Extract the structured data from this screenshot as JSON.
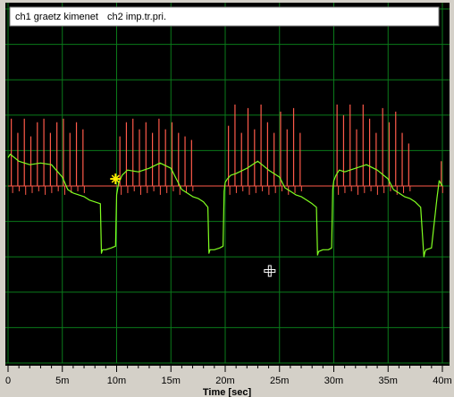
{
  "legend": {
    "ch1_label": "ch1  graetz kimenet",
    "ch2_label": "ch2  imp.tr.pri."
  },
  "colors": {
    "background": "#000000",
    "grid": "#0a7a1a",
    "ch1": "#80ff20",
    "ch2": "#ff5a4a",
    "marker": "#ffee00",
    "cursor": "#ffffff",
    "frame": "#d4d0c8"
  },
  "icons": {
    "marker": "marker-star-icon",
    "cursor": "crosshair-cursor-icon"
  },
  "chart_data": {
    "type": "line",
    "xlabel": "Time [sec]",
    "x_unit": "s",
    "xlim": [
      0,
      0.04
    ],
    "ylim": [
      -1,
      1
    ],
    "y_divisions": 10,
    "x_ticks": [
      0,
      0.005,
      0.01,
      0.015,
      0.02,
      0.025,
      0.03,
      0.035,
      0.04
    ],
    "x_tick_labels": [
      "0",
      "5m",
      "10m",
      "15m",
      "20m",
      "25m",
      "30m",
      "35m",
      "40m"
    ],
    "grid": true,
    "series": [
      {
        "name": "ch1  graetz kimenet",
        "color": "#80ff20",
        "x": [
          0,
          0.0002,
          0.001,
          0.002,
          0.003,
          0.004,
          0.005,
          0.0055,
          0.006,
          0.0065,
          0.007,
          0.0075,
          0.0085,
          0.0086,
          0.0087,
          0.009,
          0.0095,
          0.0099,
          0.01,
          0.0102,
          0.0105,
          0.011,
          0.012,
          0.013,
          0.014,
          0.015,
          0.0155,
          0.016,
          0.0165,
          0.017,
          0.0175,
          0.018,
          0.0184,
          0.0185,
          0.0186,
          0.019,
          0.0195,
          0.0198,
          0.0199,
          0.02,
          0.0202,
          0.0205,
          0.021,
          0.022,
          0.023,
          0.024,
          0.025,
          0.0255,
          0.026,
          0.0265,
          0.027,
          0.0275,
          0.028,
          0.0284,
          0.0285,
          0.0286,
          0.029,
          0.0295,
          0.0298,
          0.0299,
          0.03,
          0.0302,
          0.0305,
          0.031,
          0.032,
          0.033,
          0.034,
          0.035,
          0.0355,
          0.036,
          0.0365,
          0.037,
          0.0375,
          0.038,
          0.0383,
          0.0384,
          0.0385,
          0.039,
          0.0395,
          0.0397,
          0.04
        ],
        "y": [
          0.16,
          0.18,
          0.14,
          0.12,
          0.13,
          0.12,
          0.05,
          -0.02,
          -0.04,
          -0.05,
          -0.06,
          -0.08,
          -0.1,
          -0.38,
          -0.36,
          -0.36,
          -0.35,
          -0.34,
          -0.05,
          0.02,
          0.06,
          0.09,
          0.08,
          0.1,
          0.13,
          0.1,
          0.04,
          -0.02,
          -0.04,
          -0.06,
          -0.07,
          -0.09,
          -0.12,
          -0.38,
          -0.36,
          -0.36,
          -0.35,
          -0.34,
          -0.03,
          0.02,
          0.04,
          0.06,
          0.07,
          0.1,
          0.14,
          0.09,
          0.05,
          -0.01,
          -0.03,
          -0.05,
          -0.06,
          -0.08,
          -0.1,
          -0.12,
          -0.39,
          -0.37,
          -0.36,
          -0.36,
          -0.35,
          -0.02,
          0.03,
          0.06,
          0.09,
          0.08,
          0.1,
          0.12,
          0.09,
          0.04,
          -0.02,
          -0.04,
          -0.06,
          -0.07,
          -0.09,
          -0.12,
          -0.4,
          -0.37,
          -0.36,
          -0.35,
          -0.07,
          0.03,
          0.0
        ]
      },
      {
        "name": "ch2  imp.tr.pri.",
        "color": "#ff5a4a",
        "baseline": 0.0,
        "spike_x": [
          0.0003,
          0.0009,
          0.0015,
          0.0021,
          0.0027,
          0.0033,
          0.0039,
          0.0045,
          0.0051,
          0.0057,
          0.0063,
          0.0069,
          0.0103,
          0.0109,
          0.0115,
          0.0121,
          0.0127,
          0.0133,
          0.0139,
          0.0145,
          0.0151,
          0.0157,
          0.0163,
          0.0169,
          0.0203,
          0.0209,
          0.0215,
          0.0221,
          0.0227,
          0.0233,
          0.0239,
          0.0245,
          0.0251,
          0.0257,
          0.0263,
          0.0269,
          0.0303,
          0.0309,
          0.0315,
          0.0321,
          0.0327,
          0.0333,
          0.0339,
          0.0345,
          0.0351,
          0.0357,
          0.0363,
          0.0369,
          0.0399
        ],
        "spike_y": [
          0.38,
          0.3,
          0.38,
          0.28,
          0.36,
          0.38,
          0.3,
          0.36,
          0.38,
          0.3,
          0.36,
          0.32,
          0.28,
          0.36,
          0.38,
          0.32,
          0.36,
          0.3,
          0.38,
          0.32,
          0.36,
          0.3,
          0.28,
          0.26,
          0.34,
          0.46,
          0.3,
          0.44,
          0.32,
          0.46,
          0.36,
          0.3,
          0.42,
          0.32,
          0.44,
          0.3,
          0.46,
          0.4,
          0.46,
          0.32,
          0.46,
          0.38,
          0.3,
          0.44,
          0.36,
          0.42,
          0.3,
          0.24,
          0.14
        ],
        "dip_y": [
          -0.04,
          -0.03,
          -0.05,
          -0.04,
          -0.03,
          -0.05,
          -0.04,
          -0.03,
          -0.05,
          -0.04,
          -0.03,
          -0.04,
          -0.05,
          -0.04,
          -0.03,
          -0.05,
          -0.04,
          -0.03,
          -0.05,
          -0.04,
          -0.03,
          -0.05,
          -0.04,
          -0.03,
          -0.05,
          -0.04,
          -0.03,
          -0.05,
          -0.04,
          -0.03,
          -0.05,
          -0.04,
          -0.03,
          -0.05,
          -0.04,
          -0.03,
          -0.05,
          -0.04,
          -0.03,
          -0.05,
          -0.04,
          -0.03,
          -0.05,
          -0.04,
          -0.03,
          -0.05,
          -0.04,
          -0.03,
          -0.04
        ]
      }
    ],
    "marker": {
      "x": 0.0099,
      "y": 0.04
    },
    "cursor": {
      "x": 0.0241,
      "y": -0.48
    }
  }
}
